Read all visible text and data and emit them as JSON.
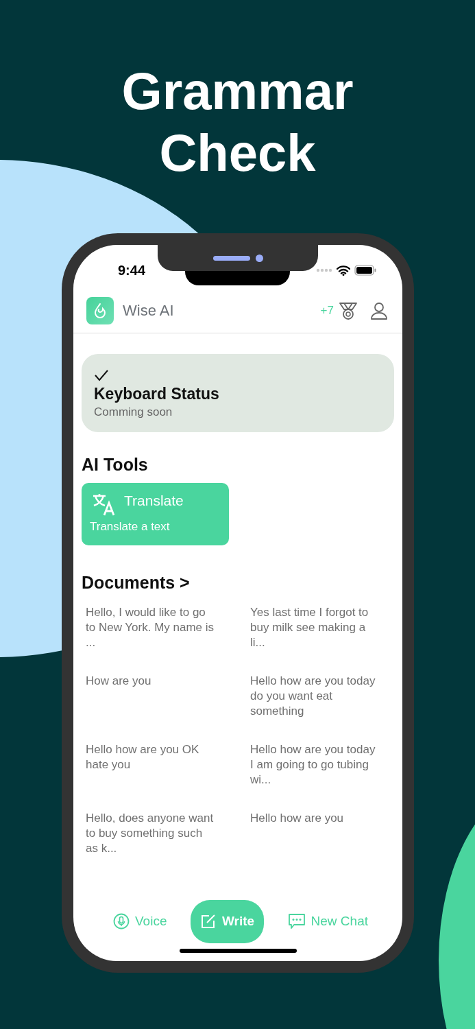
{
  "headline": [
    "Grammar",
    "Check"
  ],
  "status_bar": {
    "time": "9:44"
  },
  "header": {
    "app_name": "Wise AI",
    "points": "+7"
  },
  "keyboard_status": {
    "title": "Keyboard Status",
    "subtitle": "Comming soon"
  },
  "ai_tools": {
    "title": "AI Tools",
    "tools": [
      {
        "title": "Translate",
        "subtitle": "Translate a text"
      }
    ]
  },
  "documents": {
    "title": "Documents",
    "chevron": ">",
    "items": [
      {
        "text": "Hello, I would like to go to New York. My name is ..."
      },
      {
        "text": "Yes last time I forgot to buy milk see making a li..."
      },
      {
        "text": "How are you"
      },
      {
        "text": "Hello how are you today do you want eat something"
      },
      {
        "text": "Hello how are you OK hate you"
      },
      {
        "text": "Hello how are you today I am going to go tubing wi..."
      },
      {
        "text": "Hello, does anyone want to buy something such as k..."
      },
      {
        "text": "Hello how are you"
      }
    ]
  },
  "bottom_bar": [
    {
      "kind": "voice",
      "label": "Voice",
      "selected": false
    },
    {
      "kind": "write",
      "label": "Write",
      "selected": true
    },
    {
      "kind": "chat",
      "label": "New Chat",
      "selected": false
    }
  ]
}
